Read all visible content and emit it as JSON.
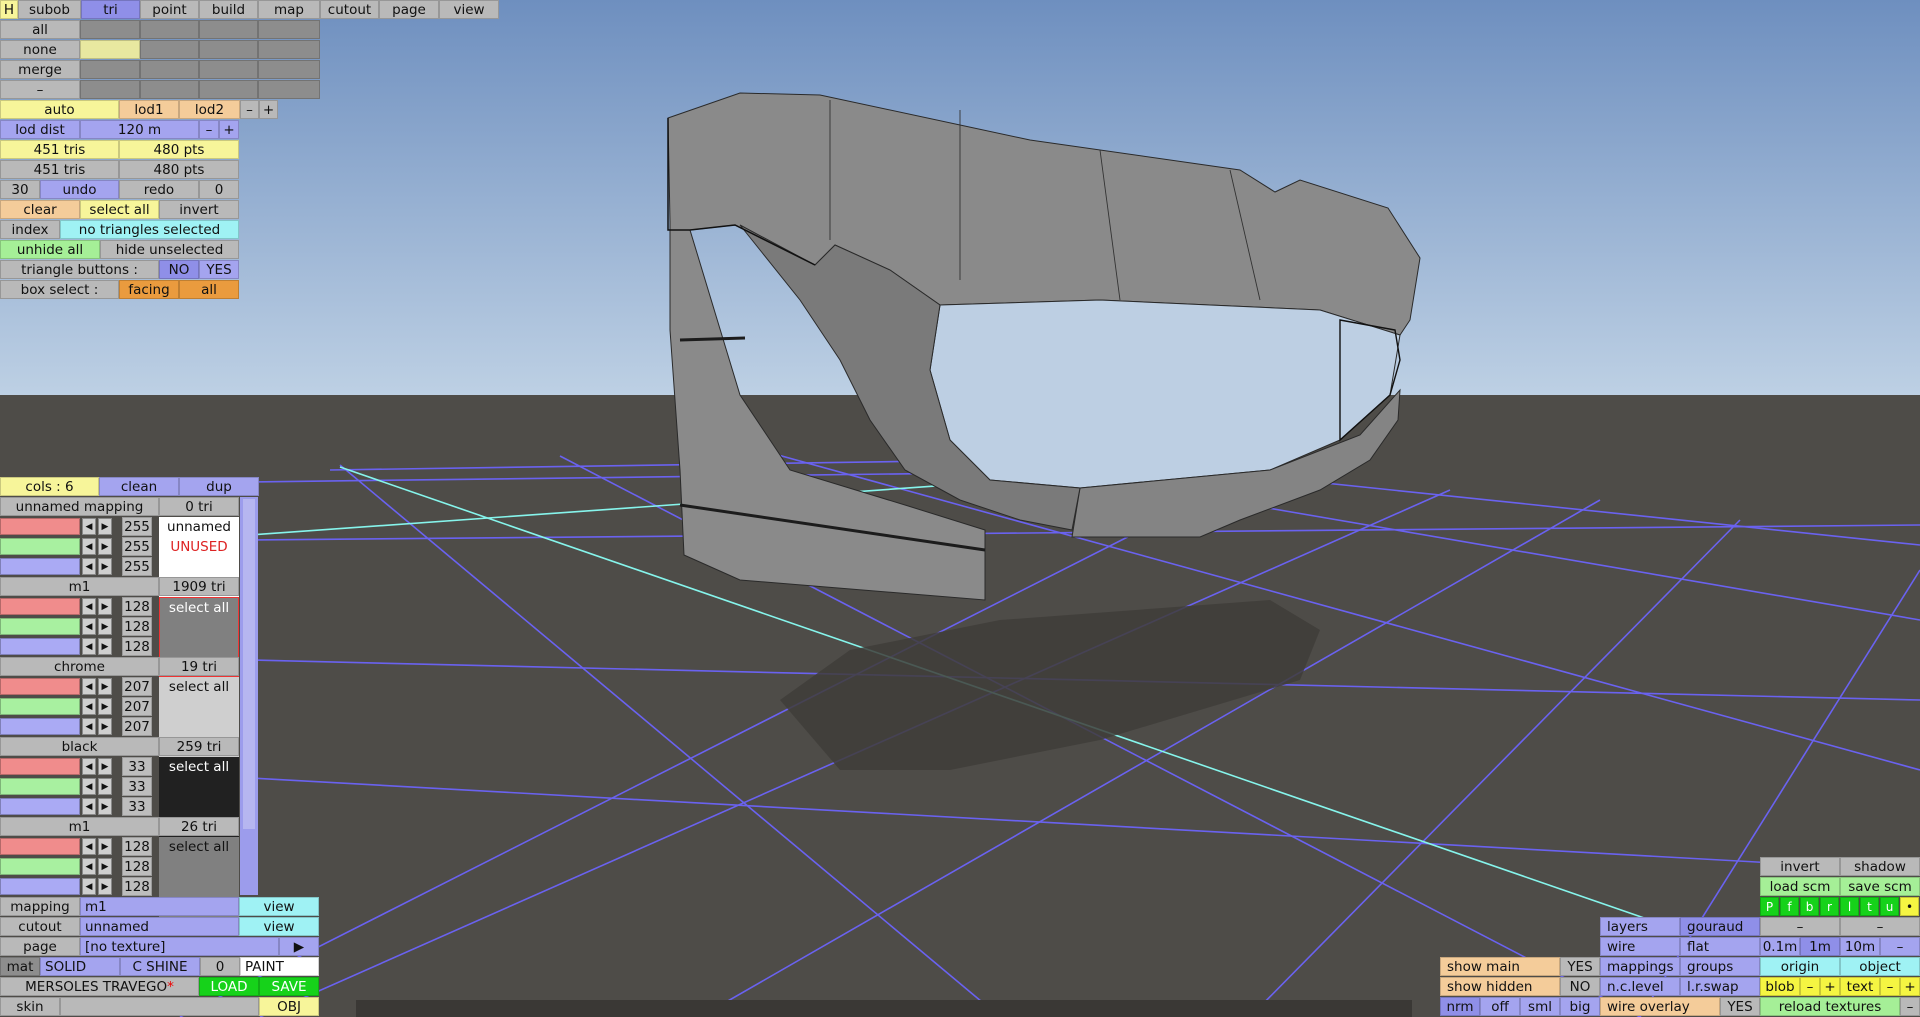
{
  "top_tabs": {
    "h": "H",
    "subob": "subob",
    "tri": "tri",
    "point": "point",
    "build": "build",
    "map": "map",
    "cutout": "cutout",
    "page": "page",
    "view": "view"
  },
  "sel_rows": {
    "all": "all",
    "none": "none",
    "merge": "merge",
    "minus": "–"
  },
  "lod": {
    "auto": "auto",
    "lod1": "lod1",
    "lod2": "lod2",
    "minus": "–",
    "plus": "+",
    "dist_label": "lod dist",
    "dist_value": "120 m"
  },
  "stats": {
    "tris1": "451 tris",
    "pts1": "480 pts",
    "tris2": "451 tris",
    "pts2": "480 pts"
  },
  "undo": {
    "count": "30",
    "undo": "undo",
    "redo": "redo",
    "redo_count": "0"
  },
  "select": {
    "clear": "clear",
    "select_all": "select all",
    "invert": "invert",
    "index": "index",
    "status": "no triangles selected",
    "unhide_all": "unhide all",
    "hide_unselected": "hide unselected"
  },
  "tri_buttons": {
    "label": "triangle buttons :",
    "no": "NO",
    "yes": "YES"
  },
  "box_select": {
    "label": "box select :",
    "facing": "facing",
    "all": "all"
  },
  "materials_header": {
    "cols": "cols : 6",
    "clean": "clean",
    "dup": "dup"
  },
  "materials": [
    {
      "name": "unnamed mapping",
      "tris": "0 tri",
      "r": "255",
      "g": "255",
      "b": "255",
      "label": "unnamed",
      "sublabel": "UNUSED",
      "swatch": "#ffffff",
      "text_color": "#111111"
    },
    {
      "name": "m1",
      "tris": "1909 tri",
      "r": "128",
      "g": "128",
      "b": "128",
      "label": "select all",
      "sublabel": "",
      "swatch": "#808080",
      "text_color": "#ffffff"
    },
    {
      "name": "chrome",
      "tris": "19 tri",
      "r": "207",
      "g": "207",
      "b": "207",
      "label": "select all",
      "sublabel": "",
      "swatch": "#cfcfcf",
      "text_color": "#111111"
    },
    {
      "name": "black",
      "tris": "259 tri",
      "r": "33",
      "g": "33",
      "b": "33",
      "label": "select all",
      "sublabel": "",
      "swatch": "#212121",
      "text_color": "#ffffff"
    },
    {
      "name": "m1",
      "tris": "26 tri",
      "r": "128",
      "g": "128",
      "b": "128",
      "label": "select all",
      "sublabel": "",
      "swatch": "#808080",
      "text_color": "#111111"
    }
  ],
  "bottom_left": {
    "mapping_label": "mapping",
    "mapping_value": "m1",
    "view1": "view",
    "cutout_label": "cutout",
    "cutout_value": "unnamed",
    "view2": "view",
    "page_label": "page",
    "page_value": "[no texture]",
    "page_arrow": "▶",
    "mat": "mat",
    "solid": "SOLID",
    "cshine": "C SHINE",
    "zero": "0",
    "paint": "PAINT",
    "file_name": "MERSOLES TRAVEGO",
    "star": "*",
    "load": "LOAD",
    "save": "SAVE",
    "skin": "skin",
    "obj": "OBJ"
  },
  "bottom_right": {
    "invert": "invert",
    "shadow": "shadow",
    "load_scm": "load scm",
    "save_scm": "save scm",
    "p_buttons": [
      "P",
      "f",
      "b",
      "r",
      "l",
      "t",
      "u",
      "•"
    ],
    "layers": "layers",
    "gouraud": "gouraud",
    "minus1": "–",
    "minus2": "–",
    "wire": "wire",
    "flat": "flat",
    "s01": "0.1m",
    "s1": "1m",
    "s10": "10m",
    "sminus": "–",
    "show_main": "show main",
    "show_main_val": "YES",
    "mappings": "mappings",
    "groups": "groups",
    "origin": "origin",
    "object": "object",
    "show_hidden": "show hidden",
    "show_hidden_val": "NO",
    "nclevel": "n.c.level",
    "lrswap": "l.r.swap",
    "blob": "blob",
    "bminus": "–",
    "bplus": "+",
    "text": "text",
    "tminus": "–",
    "tplus": "+",
    "nrm": "nrm",
    "off": "off",
    "sml": "sml",
    "big": "big",
    "wire_overlay": "wire overlay",
    "wire_overlay_val": "YES",
    "reload_textures": "reload textures",
    "rminus": "–"
  },
  "colors": {
    "sky_top": "#6e8fbf",
    "sky_bottom": "#b8cde3",
    "ground": "#4e4c48",
    "grid": "#6a62f0",
    "axis": "#86f5ec",
    "mesh": "#8a8a8a",
    "shadow": "#3f3d39"
  }
}
